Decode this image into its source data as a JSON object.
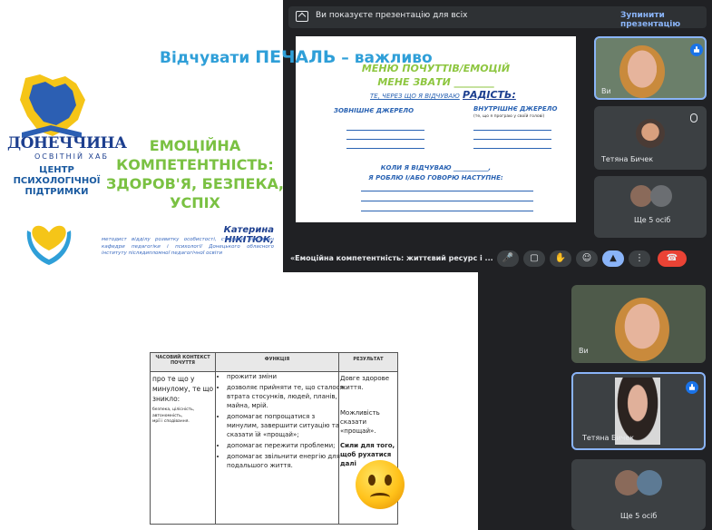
{
  "title_slide": {
    "logo_word": "ДОНЕЧЧИНА",
    "logo_sub": "ОСВІТНІЙ ХАБ",
    "center_name": "ЦЕНТР\nПСИХОЛОГІЧНОЇ\nПІДТРИМКИ",
    "title": "ЕМОЦІЙНА\nКОМПЕТЕНТНІСТЬ:\nЗДОРОВ'Я, БЕЗПЕКА,\nУСПІХ",
    "author": "Катерина НІКІТЮК,",
    "author_desc": "методист відділу розвитку особистості, старший викладач кафедри педагогіки і психології Донецького обласного інституту післядипломної педагогічної освіти"
  },
  "meet_top": {
    "share_text": "Ви показуєте презентацію для всіх",
    "stop_button": "Зупинити презентацію",
    "caption": "«Емоційна компетентність: життєвий ресурс і ...",
    "tiles": [
      {
        "name": "Ви"
      },
      {
        "name": "Тетяна Бичек"
      },
      {
        "name": "Ще 5 осіб"
      }
    ],
    "controls": [
      "mic-icon",
      "camera-icon",
      "hand-icon",
      "emoji-icon",
      "present-icon",
      "more-icon",
      "end-call-icon"
    ]
  },
  "emotion_slide": {
    "title": "МЕНЮ ПОЧУТТІВ/ЕМОЦІЙ\nМЕНЕ ЗВАТИ ________",
    "feel_line": "ТЕ, ЧЕРЕЗ ЩО Я ВІДЧУВАЮ",
    "joy": "РАДІСТЬ:",
    "external": "ЗОВНІШНЄ ДЖЕРЕЛО",
    "internal": "ВНУТРІШНЄ ДЖЕРЕЛО",
    "internal_note": "(те, що я програю у своїй голові)",
    "when": "КОЛИ Я ВІДЧУВАЮ ___________,",
    "then": "Я РОБЛЮ І/АБО ГОВОРЮ НАСТУПНЕ:"
  },
  "sad_slide": {
    "title_prefix": "Відчувати ",
    "title_emph": "ПЕЧАЛЬ",
    "title_suffix": " – важливо",
    "headers": [
      "ЧАСОВИЙ КОНТЕКСТ\nПОЧУТТЯ",
      "ФУНКЦІЯ",
      "РЕЗУЛЬТАТ"
    ],
    "context_text": "про те що у\nминулому, те що\nзникло:",
    "context_small": "безпека, цілісність,\nавтономність,\nмрії і сподівання.",
    "functions": [
      "прожити зміни",
      "дозволяє  прийняти те, що сталося: втрата стосунків, людей, планів, майна, мрій.",
      "допомагає попрощатися з минулим, завершити ситуацію та сказати їй «прощай»;",
      "допомагає пережити проблеми;",
      "допомагає звільнити енергію для подальшого життя."
    ],
    "results": [
      "Довге здорове життя.",
      "Можливість сказати «прощай».",
      "Сили для того, щоб рухатися далі"
    ]
  },
  "meet_bottom": {
    "tiles": [
      {
        "name": "Ви"
      },
      {
        "name": "Тетяна Бичек"
      },
      {
        "name": "Ще 5 осіб"
      }
    ]
  }
}
